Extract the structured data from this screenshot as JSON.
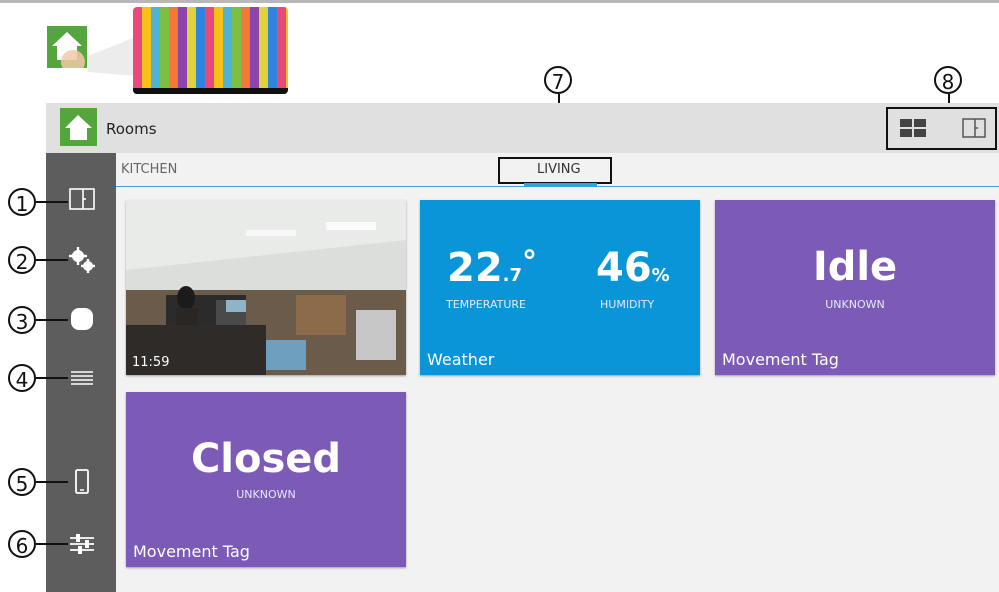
{
  "callouts": [
    "1",
    "2",
    "3",
    "4",
    "5",
    "6",
    "7",
    "8"
  ],
  "app": {
    "title": "Rooms",
    "tabs": [
      "KITCHEN",
      "LIVING"
    ],
    "active_tab": "LIVING"
  },
  "sidebar": {
    "icons": [
      "floorplan-icon",
      "gears-icon",
      "blob-icon",
      "list-icon",
      "phone-icon",
      "sliders-icon"
    ]
  },
  "header_actions": [
    "grid-view-icon",
    "floorplan-view-icon"
  ],
  "tiles": {
    "camera": {
      "time": "11:59"
    },
    "weather": {
      "temp_int": "22",
      "temp_dec": ".7",
      "temp_unit": "°",
      "temp_label": "TEMPERATURE",
      "hum": "46",
      "hum_unit": "%",
      "hum_label": "HUMIDITY",
      "label": "Weather"
    },
    "movement1": {
      "status": "Idle",
      "sub": "UNKNOWN",
      "label": "Movement Tag"
    },
    "movement2": {
      "status": "Closed",
      "sub": "UNKNOWN",
      "label": "Movement Tag"
    }
  },
  "colors": {
    "green": "#53a53c",
    "blue": "#0b95d9",
    "purple": "#7b5bb5",
    "sidebar": "#5d5d5d"
  }
}
